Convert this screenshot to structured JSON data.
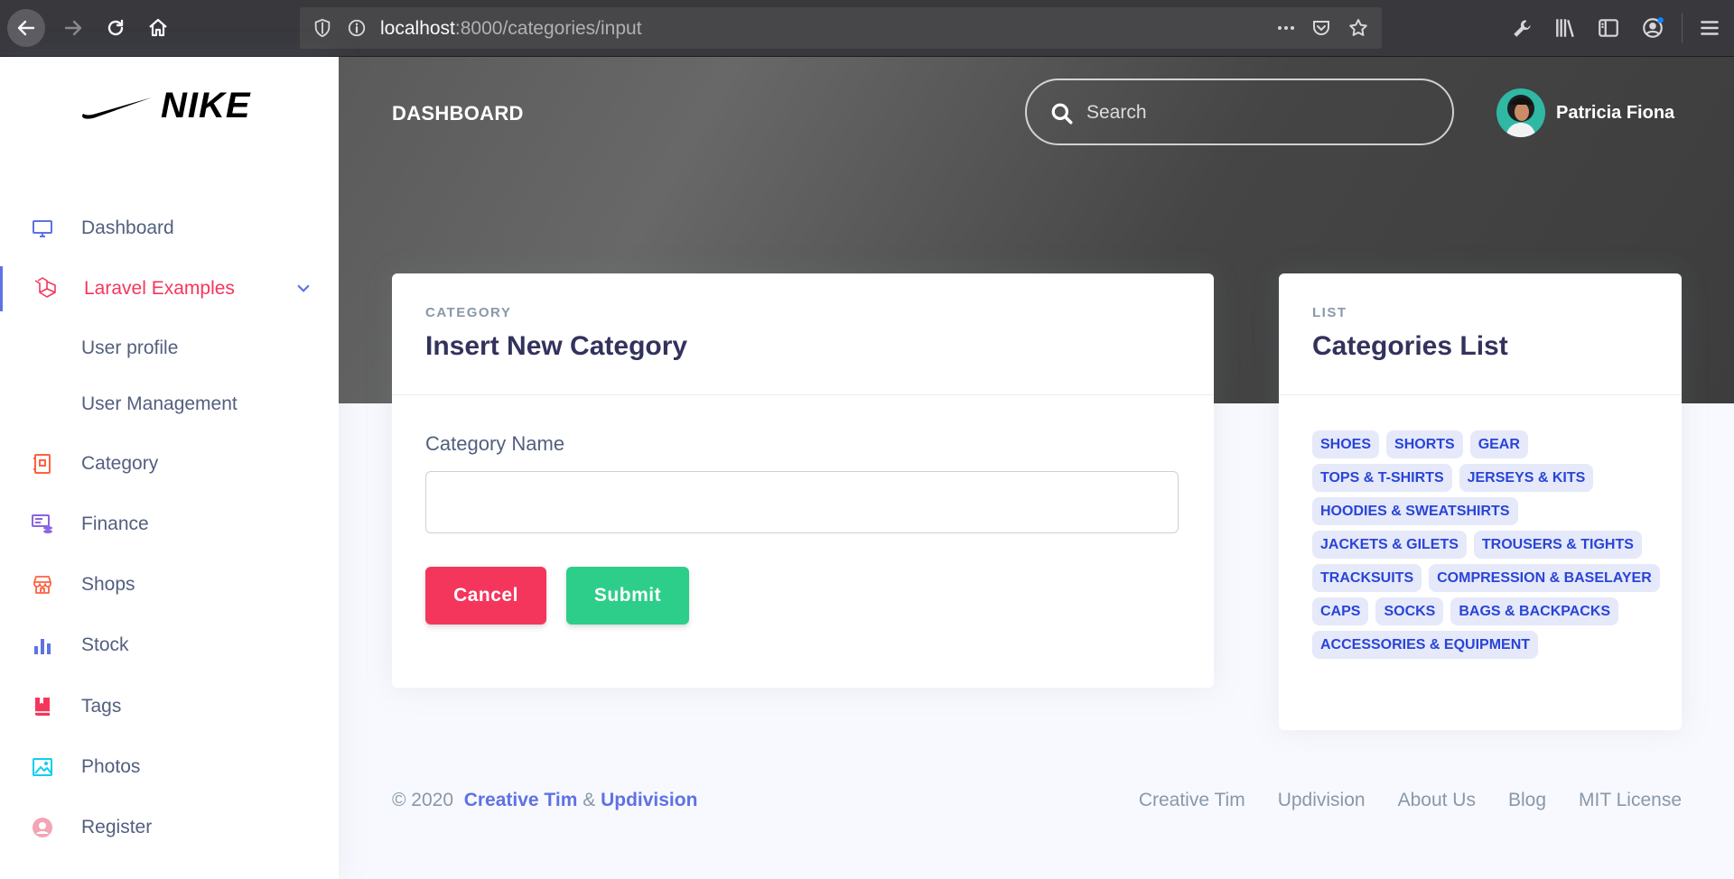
{
  "browser": {
    "url_host": "localhost",
    "url_path": ":8000/categories/input"
  },
  "brand": {
    "name": "NIKE"
  },
  "sidebar": {
    "items": [
      {
        "label": "Dashboard",
        "icon": "monitor-icon"
      },
      {
        "label": "Laravel Examples",
        "icon": "laravel-icon",
        "active": true
      },
      {
        "label": "User profile"
      },
      {
        "label": "User Management"
      },
      {
        "label": "Category",
        "icon": "category-icon"
      },
      {
        "label": "Finance",
        "icon": "finance-icon"
      },
      {
        "label": "Shops",
        "icon": "shop-icon"
      },
      {
        "label": "Stock",
        "icon": "chart-bar-icon"
      },
      {
        "label": "Tags",
        "icon": "book-icon"
      },
      {
        "label": "Photos",
        "icon": "image-icon"
      },
      {
        "label": "Register",
        "icon": "user-icon"
      }
    ]
  },
  "header": {
    "title": "DASHBOARD",
    "search_placeholder": "Search",
    "user_name": "Patricia Fiona"
  },
  "insert_card": {
    "kicker": "CATEGORY",
    "title": "Insert New Category",
    "field_label": "Category Name",
    "field_value": "",
    "cancel_label": "Cancel",
    "submit_label": "Submit"
  },
  "list_card": {
    "kicker": "LIST",
    "title": "Categories List",
    "tags": [
      "SHOES",
      "SHORTS",
      "GEAR",
      "TOPS & T-SHIRTS",
      "JERSEYS & KITS",
      "HOODIES & SWEATSHIRTS",
      "JACKETS & GILETS",
      "TROUSERS & TIGHTS",
      "TRACKSUITS",
      "COMPRESSION & BASELAYER",
      "CAPS",
      "SOCKS",
      "BAGS & BACKPACKS",
      "ACCESSORIES & EQUIPMENT"
    ]
  },
  "footer": {
    "copyright": "© 2020",
    "link1": "Creative Tim",
    "amp": "&",
    "link2": "Updivision",
    "links": [
      "Creative Tim",
      "Updivision",
      "About Us",
      "Blog",
      "MIT License"
    ]
  },
  "colors": {
    "accent": "#5e72e4",
    "danger": "#f5365c",
    "success": "#2dce89"
  }
}
